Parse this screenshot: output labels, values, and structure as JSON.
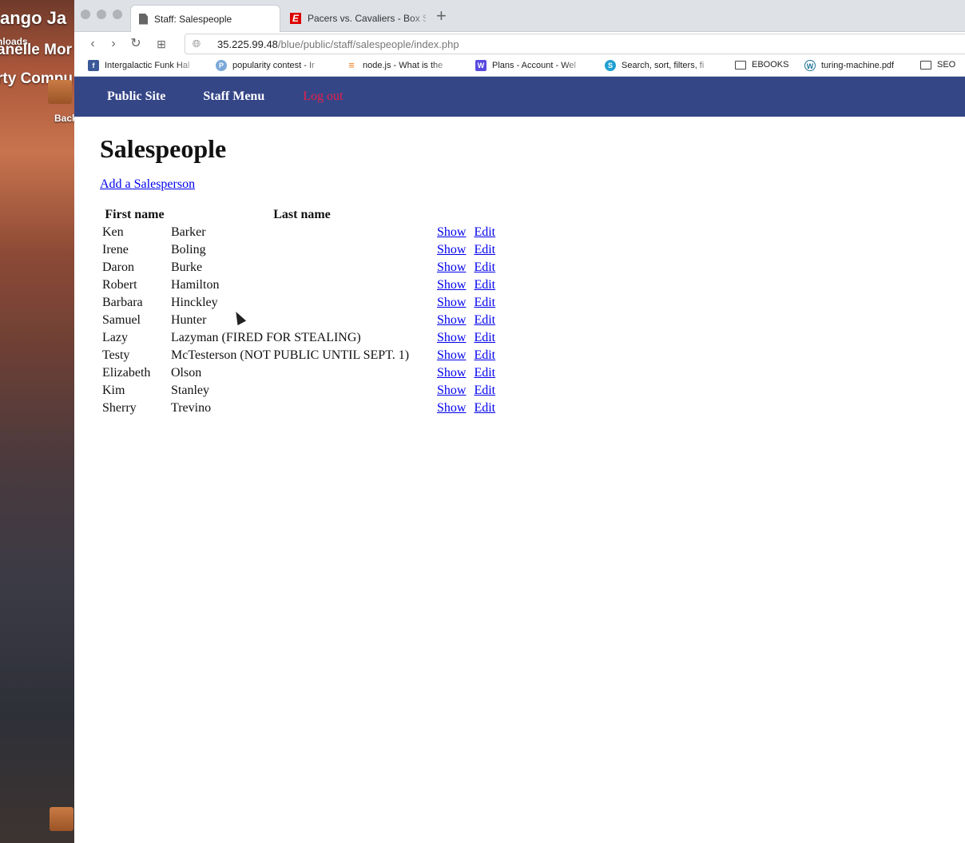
{
  "desktop": {
    "line1": "ango Ja",
    "line2": "nloads",
    "line3": "anelle Mor",
    "line4": "rty Compu",
    "line5": "Back"
  },
  "browser": {
    "tabs": [
      {
        "title": "Staff: Salespeople",
        "active": true
      },
      {
        "title": "Pacers vs. Cavaliers - Box Sc",
        "active": false
      }
    ],
    "new_tab": "+",
    "url_host": "35.225.99.48",
    "url_path": "/blue/public/staff/salespeople/index.php",
    "bookmarks": [
      {
        "label": "Intergalactic Funk Hal",
        "icon": "facebook-icon"
      },
      {
        "label": "popularity contest - Ir",
        "icon": "pcg-icon"
      },
      {
        "label": "node.js - What is the",
        "icon": "stackoverflow-icon"
      },
      {
        "label": "Plans - Account - Wel",
        "icon": "w-icon"
      },
      {
        "label": "Search, sort, filters, fi",
        "icon": "s-icon"
      },
      {
        "label": "EBOOKS",
        "icon": "folder-icon"
      },
      {
        "label": "turing-machine.pdf",
        "icon": "wordpress-icon"
      },
      {
        "label": "SEO",
        "icon": "folder-icon"
      }
    ]
  },
  "nav": {
    "public_site": "Public Site",
    "staff_menu": "Staff Menu",
    "log_out": "Log out"
  },
  "page": {
    "title": "Salespeople",
    "add_link": "Add a Salesperson"
  },
  "table": {
    "headers": [
      "First name",
      "Last name"
    ],
    "show_label": "Show",
    "edit_label": "Edit",
    "rows": [
      {
        "first": "Ken",
        "last": "Barker"
      },
      {
        "first": "Irene",
        "last": "Boling"
      },
      {
        "first": "Daron",
        "last": "Burke"
      },
      {
        "first": "Robert",
        "last": "Hamilton"
      },
      {
        "first": "Barbara",
        "last": "Hinckley"
      },
      {
        "first": "Samuel",
        "last": "Hunter"
      },
      {
        "first": "Lazy",
        "last": "Lazyman (FIRED FOR STEALING)"
      },
      {
        "first": "Testy",
        "last": "McTesterson (NOT PUBLIC UNTIL SEPT. 1)"
      },
      {
        "first": "Elizabeth",
        "last": "Olson"
      },
      {
        "first": "Kim",
        "last": "Stanley"
      },
      {
        "first": "Sherry",
        "last": "Trevino"
      }
    ]
  },
  "colors": {
    "nav_bg": "#354687",
    "logout": "#e8204a",
    "link": "#0000ee"
  }
}
